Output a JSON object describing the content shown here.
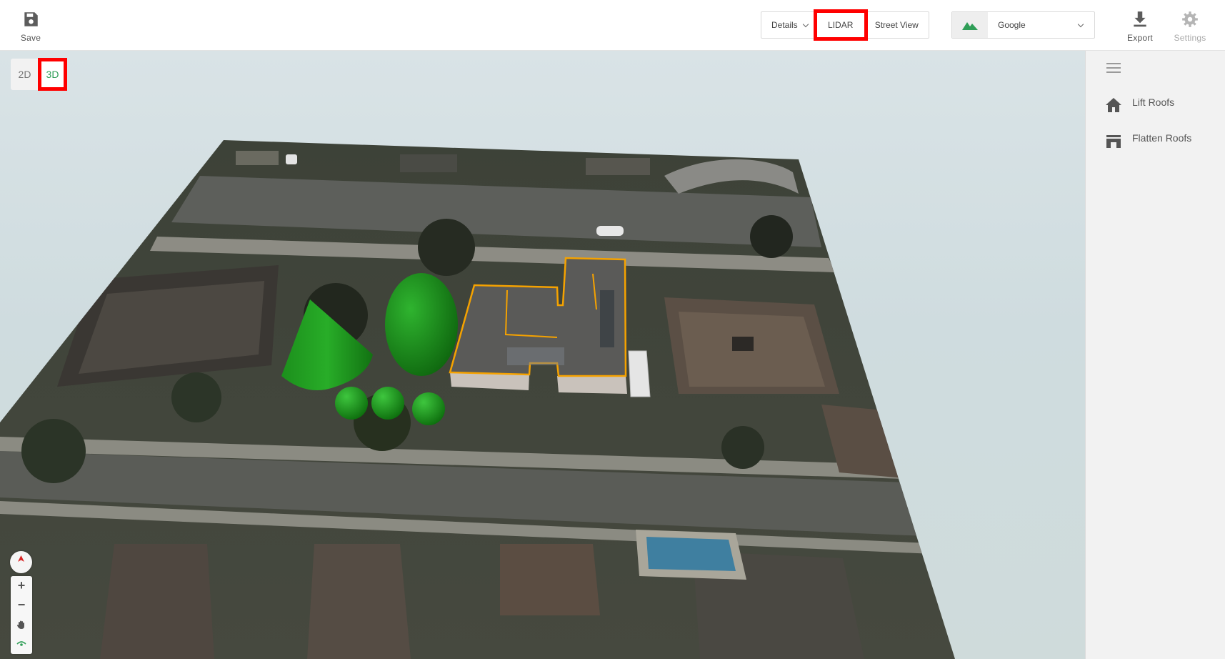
{
  "toolbar": {
    "save_label": "Save",
    "export_label": "Export",
    "settings_label": "Settings"
  },
  "view_tabs": {
    "details_label": "Details",
    "lidar_label": "LIDAR",
    "street_view_label": "Street View"
  },
  "imagery_provider": {
    "selected": "Google"
  },
  "dimension_toggle": {
    "two_d_label": "2D",
    "three_d_label": "3D",
    "active": "3D"
  },
  "sidebar": {
    "items": [
      {
        "label": "Lift Roofs",
        "icon": "home-icon"
      },
      {
        "label": "Flatten Roofs",
        "icon": "flatten-roof-icon"
      }
    ]
  },
  "map_controls": {
    "zoom_in": "+",
    "zoom_out": "−"
  },
  "colors": {
    "accent_green": "#2f9e57",
    "highlight_red": "#ff0000",
    "roof_outline": "#f5a200",
    "tree_green": "#1f9a1f"
  }
}
